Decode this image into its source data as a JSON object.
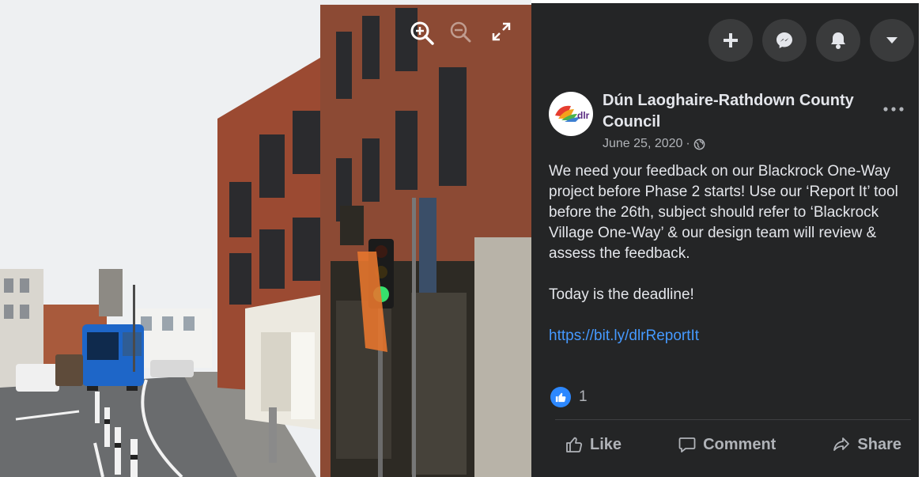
{
  "photo": {
    "controls": [
      {
        "name": "zoom-in",
        "icon": "zoom-in-icon"
      },
      {
        "name": "zoom-out",
        "icon": "zoom-out-icon"
      },
      {
        "name": "fullscreen",
        "icon": "fullscreen-icon"
      }
    ]
  },
  "topbar": {
    "buttons": [
      {
        "name": "create",
        "icon": "plus-icon"
      },
      {
        "name": "messenger",
        "icon": "messenger-icon"
      },
      {
        "name": "notifications",
        "icon": "bell-icon"
      },
      {
        "name": "account",
        "icon": "caret-down-icon"
      }
    ]
  },
  "post": {
    "page_name": "Dún Laoghaire-Rathdown County Council",
    "avatar_text": "dlr",
    "date": "June 25, 2020",
    "date_separator": "·",
    "privacy_icon": "globe-icon",
    "more_options_icon": "ellipsis-icon",
    "body": "We need your feedback on our Blackrock One-Way project before Phase 2 starts! Use our ‘Report It’ tool before the 26th, subject should refer to ‘Blackrock Village One-Way’ & our design team will review & assess the feedback.",
    "deadline_text": "Today is the deadline!",
    "link_text": "https://bit.ly/dlrReportIt",
    "reaction_count": "1",
    "actions": {
      "like": "Like",
      "comment": "Comment",
      "share": "Share"
    }
  },
  "colors": {
    "panel_bg": "#242526",
    "button_bg": "#3a3b3c",
    "text_primary": "#e4e6eb",
    "text_secondary": "#b0b3b8",
    "link": "#4599ff",
    "like_blue": "#2d88ff"
  }
}
